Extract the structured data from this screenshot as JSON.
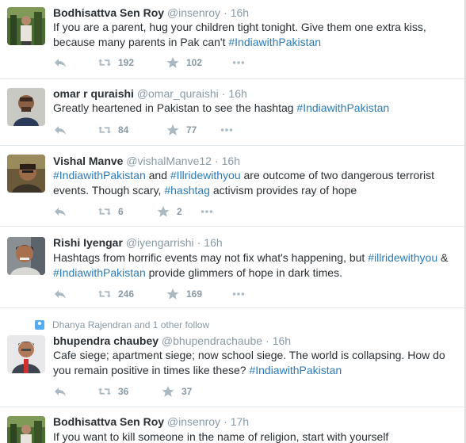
{
  "tweets": [
    {
      "name": "Bodhisattva Sen Roy",
      "handle": "@insenroy",
      "time": "16h",
      "text_before": "If you are a parent, hug your children tight tonight. Give them one extra kiss, because many parents in Pak can't ",
      "tag1": "#IndiawithPakistan",
      "text_middle": "",
      "tag2": "",
      "text_after": "",
      "retweets": "192",
      "favorites": "102"
    },
    {
      "name": "omar r quraishi",
      "handle": "@omar_quraishi",
      "time": "16h",
      "text_before": "Greatly heartened in Pakistan to see the hashtag ",
      "tag1": "#IndiawithPakistan",
      "text_middle": "",
      "tag2": "",
      "text_after": "",
      "retweets": "84",
      "favorites": "77"
    },
    {
      "name": "Vishal Manve",
      "handle": "@vishalManve12",
      "time": "16h",
      "text_before": "",
      "tag1": "#IndiawithPakistan",
      "text_middle": " and ",
      "tag2": "#Illridewithyou",
      "text_after": " are outcome of two dangerous terrorist events. Though scary, ",
      "tag3": "#hashtag",
      "text_end": " activism provides ray of hope",
      "retweets": "6",
      "favorites": "2"
    },
    {
      "name": "Rishi Iyengar",
      "handle": "@iyengarrishi",
      "time": "16h",
      "text_before": "Hashtags from horrific events may not fix what's happening, but ",
      "tag1": "#illridewithyou",
      "text_middle": " & ",
      "tag2": "#IndiawithPakistan",
      "text_after": " provide glimmers of hope in dark times.",
      "retweets": "246",
      "favorites": "169"
    },
    {
      "social_context": "Dhanya Rajendran and 1 other follow",
      "name": "bhupendra chaubey",
      "handle": "@bhupendrachaube",
      "time": "16h",
      "text_before": "Cafe siege; apartment siege; now school siege. The world is collapsing. How do you remain positive in times like these? ",
      "tag1": "#IndiawithPakistan",
      "text_middle": "",
      "tag2": "",
      "text_after": "",
      "retweets": "36",
      "favorites": "37"
    },
    {
      "name": "Bodhisattva Sen Roy",
      "handle": "@insenroy",
      "time": "17h",
      "text_before": "If you want to kill someone in the name of religion, start with yourself",
      "tag1": "",
      "text_middle": "",
      "tag2": "",
      "text_after": ""
    }
  ],
  "separator": "·",
  "icons": {
    "reply": "reply-icon",
    "retweet": "retweet-icon",
    "favorite": "star-icon",
    "more": "more-icon",
    "social": "person-icon"
  },
  "colors": {
    "hashtag": "#2b7bb9",
    "muted": "#8899a6",
    "text": "#292f33",
    "divider": "#e1e8ed"
  }
}
